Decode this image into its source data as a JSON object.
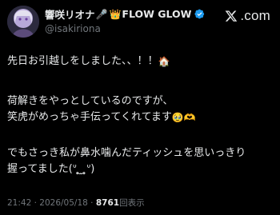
{
  "author": {
    "display_name_part1": "響咲リオナ",
    "name_emoji_1": "🎤",
    "name_emoji_2": "👑",
    "display_name_part2": "FLOW GLOW",
    "handle": "@isakiriona"
  },
  "brand": {
    "suffix": ".com"
  },
  "post": {
    "line1_text": "先日お引越しをしました、、！！",
    "line1_emoji": "🏠",
    "line2_text": "荷解きをやっとしているのですが、",
    "line3_text": "笑虎がめっちゃ手伝ってくれてます",
    "line3_emoji": "🥹🫶",
    "line4_text": "でもさっき私が鼻水噛んだティッシュを思いっきり",
    "line5_text": "握ってました(ᐡ ̥̥̥ ̫ ̥̥̥ᐡ)"
  },
  "meta": {
    "time": "21:42",
    "separator": "·",
    "date": "2026/05/18",
    "views_count": "8761",
    "views_label": "回表示"
  },
  "colors": {
    "background": "#000000",
    "text": "#e7e9ea",
    "secondary": "#71767b",
    "verified": "#1d9bf0"
  }
}
